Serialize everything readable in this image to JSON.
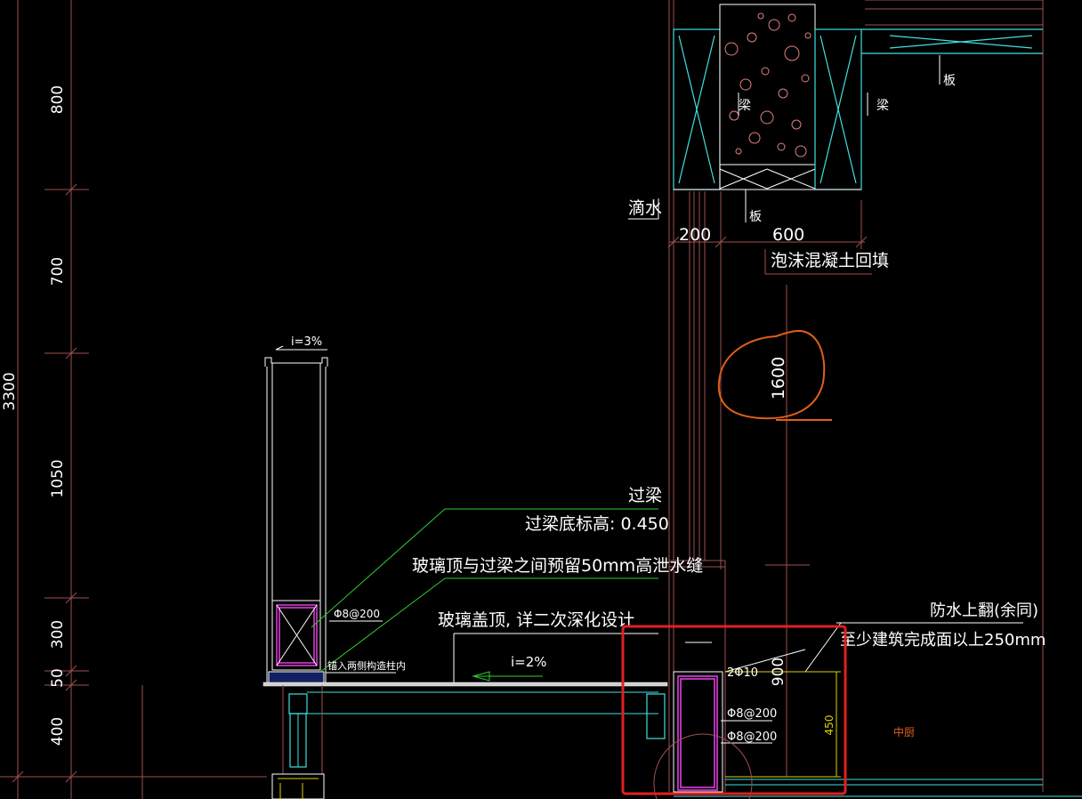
{
  "dimensions": {
    "left_total": "3300",
    "left_800": "800",
    "left_700": "700",
    "left_1050": "1050",
    "left_300": "300",
    "left_50": "50",
    "left_400": "400",
    "top_200": "200",
    "top_600": "600",
    "mid_1600": "1600",
    "right_900": "900",
    "right_450": "450"
  },
  "labels": {
    "drip": "滴水",
    "foam_fill": "泡沫混凝土回填",
    "beam_left": "梁",
    "beam_right": "梁",
    "slab_top": "板",
    "slab_bottom": "板",
    "slope_top": "i=3%",
    "slope_roof": "i=2%",
    "lintel": "过梁",
    "lintel_elev": "过梁底标高: 0.450",
    "gap_note": "玻璃顶与过梁之间预留50mm高泄水缝",
    "glass_roof": "玻璃盖顶, 详二次深化设计",
    "rebar_8_200": "Φ8@200",
    "embed_note": "锚入两侧构造柱内",
    "bar_2_10": "2Φ10",
    "rebar_a": "Φ8@200",
    "rebar_b": "Φ8@200",
    "waterproof_1": "防水上翻(余同)",
    "waterproof_2": "至少建筑完成面以上250mm",
    "room": "中厨"
  },
  "colors": {
    "background": "#000000",
    "grid": "#a05050",
    "white": "#ffffff",
    "cyan": "#40e0e0",
    "green": "#30d030",
    "magenta": "#e040e0",
    "orange_mark": "#e06018",
    "red_box": "#e02020",
    "yellow": "#e0d000",
    "blue": "#4060ff"
  }
}
